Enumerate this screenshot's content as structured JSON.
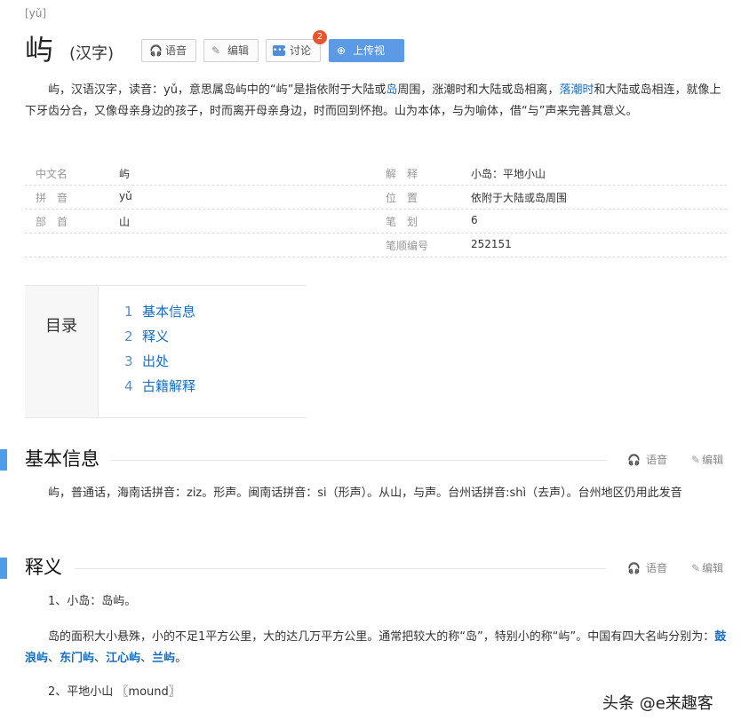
{
  "header": {
    "pinyin": "[yǔ]",
    "char": "屿",
    "subtitle": "(汉字)",
    "buttons": {
      "voice": "语音",
      "edit": "编辑",
      "discuss": "讨论",
      "discuss_badge": "2",
      "upload": "上传视频"
    }
  },
  "intro": {
    "p1": "屿，汉语汉字，读音：yǔ，意思属岛屿中的“屿”是指依附于大陆或",
    "link1": "岛",
    "p2": "周围，涨潮时和大陆或岛相离，",
    "link2": "落潮时",
    "p3": "和大陆或岛相连，就像上下牙齿分合，又像母亲身边的孩子，时而离开母亲身边，时而回到怀抱。山为本体，与为喻体，借“与”声来完善其意义。"
  },
  "infobox": {
    "rows": [
      {
        "k1": "中文名",
        "v1": "屿",
        "k2": "解　释",
        "v2": "小岛：平地小山"
      },
      {
        "k1": "拼　音",
        "v1": "yǔ",
        "k2": "位　置",
        "v2": "依附于大陆或岛周围"
      },
      {
        "k1": "部　首",
        "v1": "山",
        "k2": "笔　划",
        "v2": "6"
      },
      {
        "k1": "",
        "v1": "",
        "k2": "笔顺编号",
        "v2": "252151"
      }
    ]
  },
  "toc": {
    "label": "目录",
    "items": [
      {
        "num": "1",
        "text": "基本信息"
      },
      {
        "num": "2",
        "text": "释义"
      },
      {
        "num": "3",
        "text": "出处"
      },
      {
        "num": "4",
        "text": "古籍解释"
      }
    ]
  },
  "section1": {
    "title": "基本信息",
    "voice": "语音",
    "edit": "编辑",
    "text": "屿，普通话，海南话拼音：ziz。形声。闽南话拼音：si（形声）。从山，与声。台州话拼音:shì（去声）。台州地区仍用此发音"
  },
  "section2": {
    "title": "释义",
    "voice": "语音",
    "edit": "编辑",
    "item1": "1、小岛：岛屿。",
    "p_pre": "岛的面积大小悬殊，小的不足1平方公里，大的达几万平方公里。通常把较大的称“岛”，特别小的称“屿”。中国有四大名屿分别为：",
    "links": [
      "鼓浪屿",
      "东门屿",
      "江心屿",
      "兰屿"
    ],
    "sep": "、",
    "end": "。",
    "item2": "2、平地小山 〖mound〗"
  },
  "watermark": "头条 @e来趣客",
  "colors": {
    "accent": "#4f9de8",
    "link": "#136ec2",
    "badge": "#e8542e"
  }
}
